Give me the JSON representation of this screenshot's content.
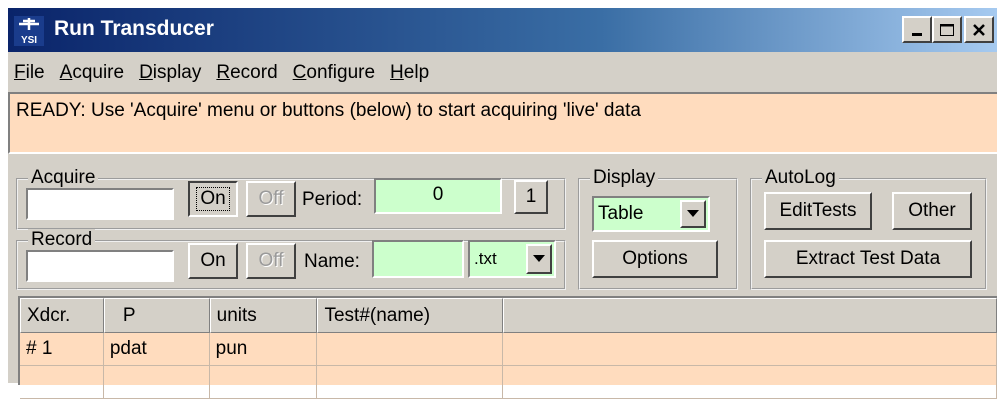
{
  "window": {
    "title": "Run Transducer",
    "icon_label": "YSI"
  },
  "menu": [
    "File",
    "Acquire",
    "Display",
    "Record",
    "Configure",
    "Help"
  ],
  "status": {
    "text": "READY: Use 'Acquire' menu or buttons (below) to start acquiring 'live' data"
  },
  "acquire": {
    "legend": "Acquire",
    "input_value": "",
    "on_label": "On",
    "off_label": "Off",
    "period_label": "Period:",
    "period_value": "0",
    "step_label": "1"
  },
  "record": {
    "legend": "Record",
    "input_value": "",
    "on_label": "On",
    "off_label": "Off",
    "name_label": "Name:",
    "name_value": "",
    "ext_value": ".txt"
  },
  "display": {
    "legend": "Display",
    "mode_value": "Table",
    "options_label": "Options"
  },
  "autolog": {
    "legend": "AutoLog",
    "edit_tests_label": "EditTests",
    "other_label": "Other",
    "extract_label": "Extract Test Data"
  },
  "table": {
    "columns": [
      "Xdcr.",
      "P",
      "units",
      "Test#(name)",
      ""
    ],
    "rows": [
      [
        "# 1",
        "pdat",
        "pun",
        "",
        ""
      ],
      [
        "",
        "",
        "",
        "",
        ""
      ]
    ]
  },
  "colors": {
    "status_bg": "#ffdcbe",
    "field_green": "#ccffcc",
    "titlebar": "#0a246a"
  }
}
